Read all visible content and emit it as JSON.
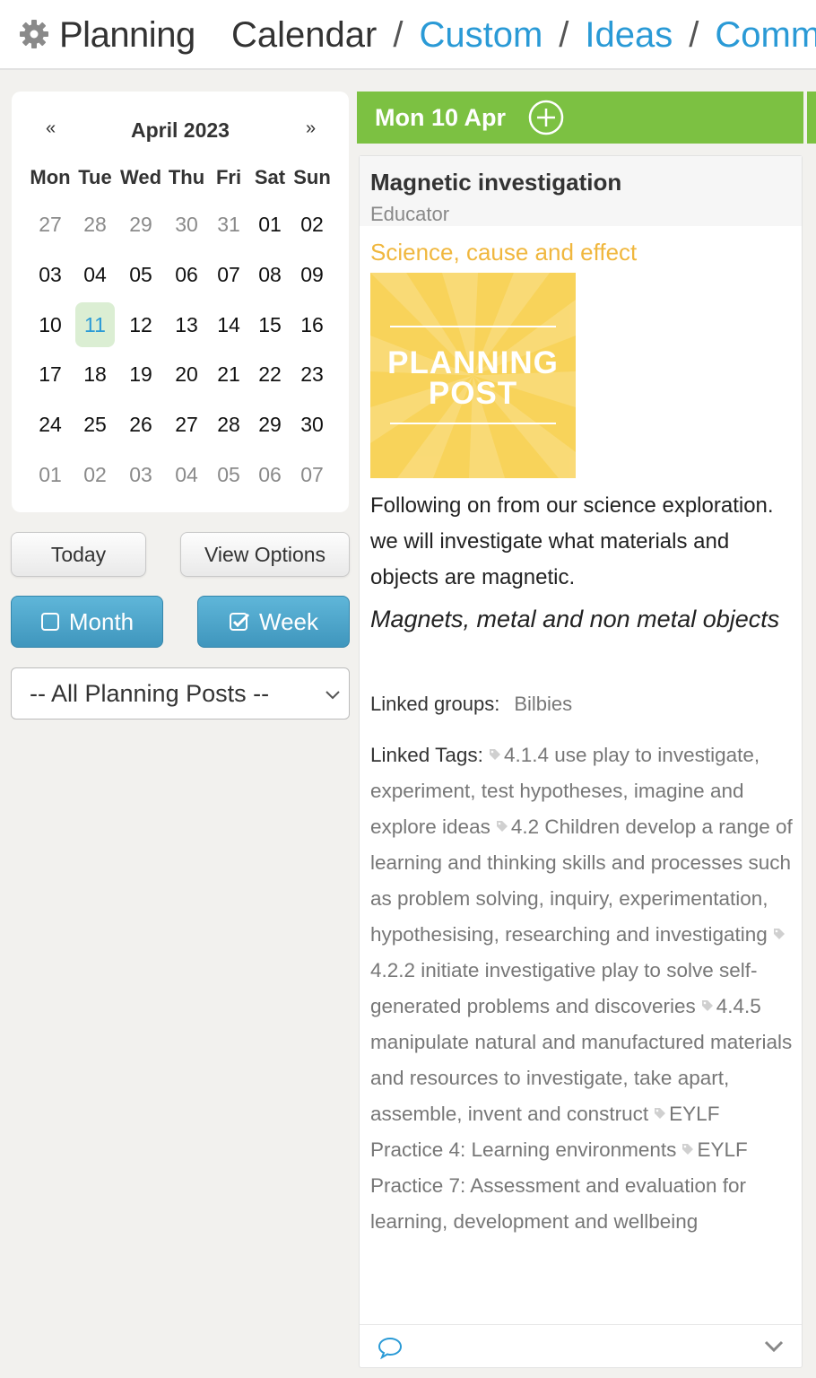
{
  "header": {
    "app_title": "Planning",
    "nav": [
      {
        "label": "Calendar",
        "current": true
      },
      {
        "label": "Custom",
        "current": false
      },
      {
        "label": "Ideas",
        "current": false
      },
      {
        "label": "Communi",
        "current": false
      }
    ],
    "separator": "/",
    "icon": "gear-icon"
  },
  "calendar": {
    "prev": "«",
    "next": "»",
    "month_label": "April 2023",
    "weekdays": [
      "Mon",
      "Tue",
      "Wed",
      "Thu",
      "Fri",
      "Sat",
      "Sun"
    ],
    "weeks": [
      [
        "27",
        "28",
        "29",
        "30",
        "31",
        "01",
        "02"
      ],
      [
        "03",
        "04",
        "05",
        "06",
        "07",
        "08",
        "09"
      ],
      [
        "10",
        "11",
        "12",
        "13",
        "14",
        "15",
        "16"
      ],
      [
        "17",
        "18",
        "19",
        "20",
        "21",
        "22",
        "23"
      ],
      [
        "24",
        "25",
        "26",
        "27",
        "28",
        "29",
        "30"
      ],
      [
        "01",
        "02",
        "03",
        "04",
        "05",
        "06",
        "07"
      ]
    ],
    "selected_day": "11"
  },
  "controls": {
    "today": "Today",
    "view_options": "View Options",
    "month": "Month",
    "week": "Week",
    "month_checked": false,
    "week_checked": true,
    "filter_value": "-- All Planning Posts --"
  },
  "day": {
    "header": "Mon 10 Apr",
    "header_color": "#7cc142"
  },
  "post": {
    "title": "Magnetic investigation",
    "role": "Educator",
    "category": "Science, cause and effect",
    "category_color": "#f0b73e",
    "image_text_line1": "PLANNING",
    "image_text_line2": "POST",
    "body": "Following on from our science exploration. we will investigate what materials and objects are magnetic.",
    "emphasis": "Magnets, metal and non metal objects",
    "linked_groups_label": "Linked groups:",
    "linked_groups_value": "Bilbies",
    "linked_tags_label": "Linked Tags:",
    "tags": [
      "4.1.4 use play to investigate, experiment, test hypotheses, imagine and explore ideas",
      "4.2 Children develop a range of learning and thinking skills and processes such as problem solving, inquiry, experimentation, hypothesising, researching and investigating",
      "4.2.2 initiate investigative play to solve self-generated problems and discoveries",
      "4.4.5 manipulate natural and manufactured materials and resources to investigate, take apart, assemble, invent and construct",
      "EYLF Practice 4: Learning environments",
      "EYLF Practice 7: Assessment and evaluation for learning, development and wellbeing"
    ]
  }
}
